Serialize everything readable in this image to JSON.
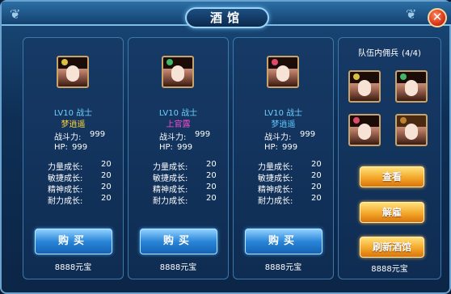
{
  "window": {
    "title": "酒馆",
    "close_icon": "close-icon"
  },
  "heroes": [
    {
      "level_class": "LV10  战士",
      "name": "梦逍遥",
      "name_color": "#ffd23a",
      "power_label": "战斗力:",
      "power_value": "999",
      "hp_label": "HP:",
      "hp_value": "999",
      "growth": [
        {
          "label": "力量成长:",
          "value": "20"
        },
        {
          "label": "敏捷成长:",
          "value": "20"
        },
        {
          "label": "精神成长:",
          "value": "20"
        },
        {
          "label": "耐力成长:",
          "value": "20"
        }
      ],
      "buy_label": "购买",
      "price": "8888元宝"
    },
    {
      "level_class": "LV10  战士",
      "name": "上官露",
      "name_color": "#ff4ad6",
      "power_label": "战斗力:",
      "power_value": "999",
      "hp_label": "HP:",
      "hp_value": "999",
      "growth": [
        {
          "label": "力量成长:",
          "value": "20"
        },
        {
          "label": "敏捷成长:",
          "value": "20"
        },
        {
          "label": "精神成长:",
          "value": "20"
        },
        {
          "label": "耐力成长:",
          "value": "20"
        }
      ],
      "buy_label": "购买",
      "price": "8888元宝"
    },
    {
      "level_class": "LV10  战士",
      "name": "梦逍遥",
      "name_color": "#5fc7ff",
      "power_label": "战斗力:",
      "power_value": "999",
      "hp_label": "HP:",
      "hp_value": "999",
      "growth": [
        {
          "label": "力量成长:",
          "value": "20"
        },
        {
          "label": "敏捷成长:",
          "value": "20"
        },
        {
          "label": "精神成长:",
          "value": "20"
        },
        {
          "label": "耐力成长:",
          "value": "20"
        }
      ],
      "buy_label": "购买",
      "price": "8888元宝"
    }
  ],
  "team": {
    "title": "队伍内佣兵",
    "count": "(4/4)",
    "view_label": "查看",
    "dismiss_label": "解雇",
    "refresh_label": "刷新酒馆",
    "refresh_price": "8888元宝"
  }
}
